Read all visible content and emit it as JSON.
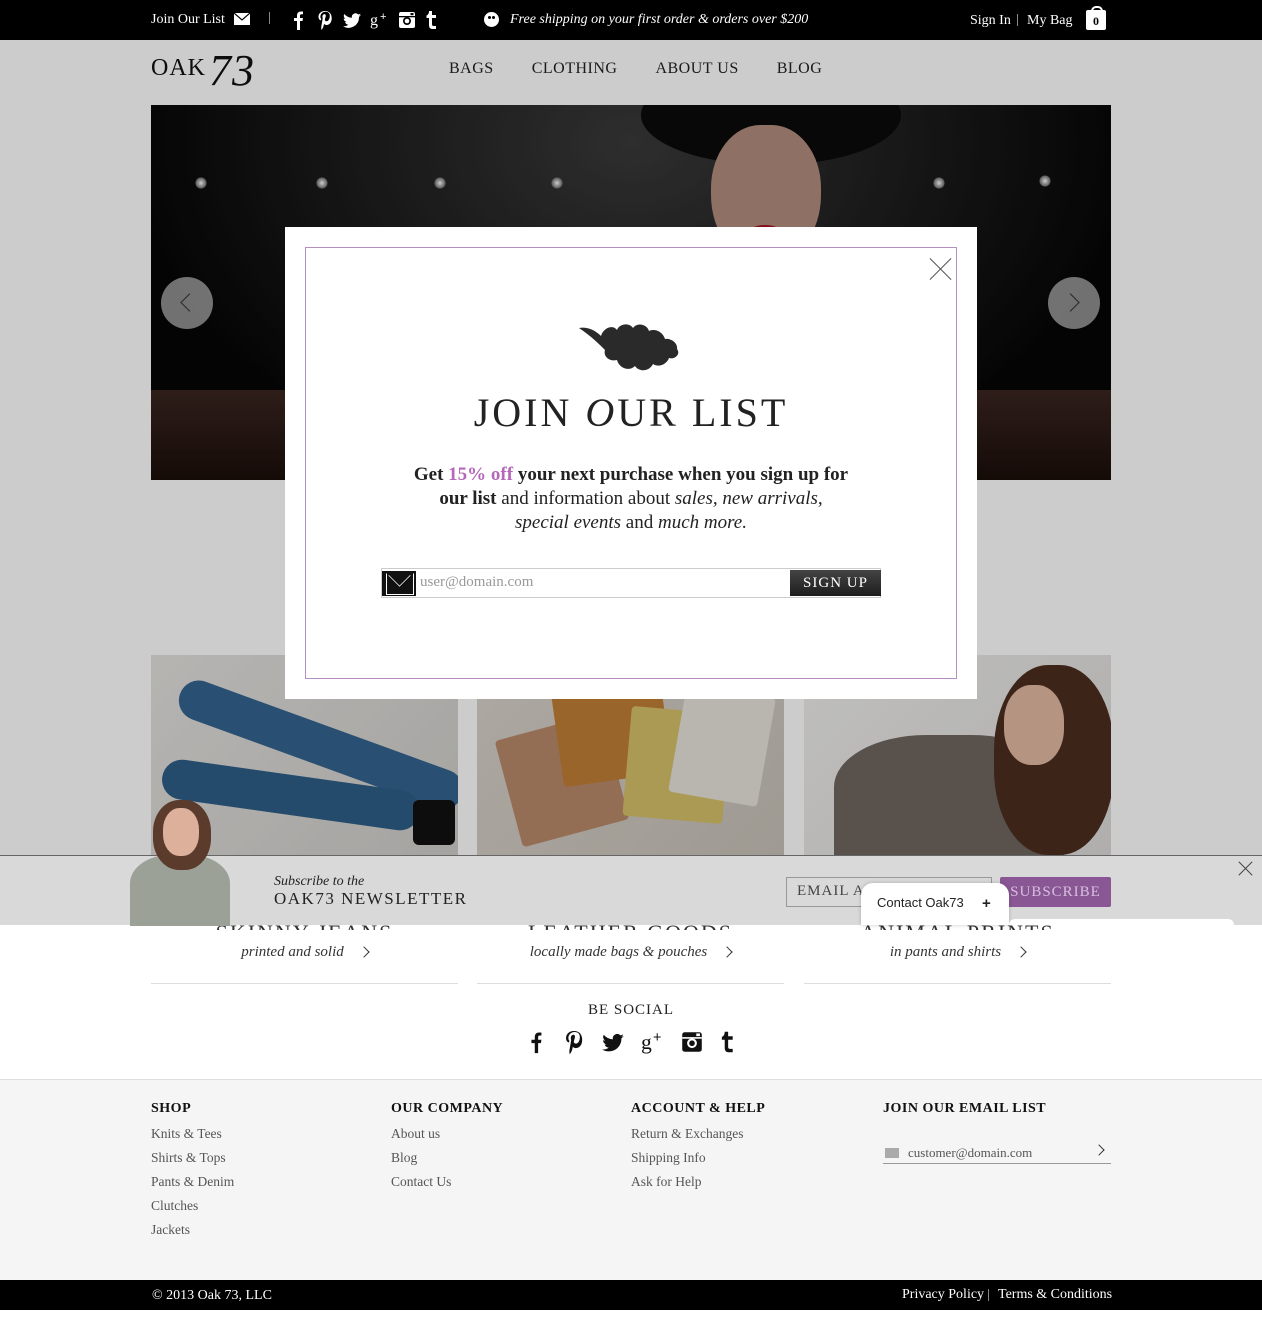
{
  "topbar": {
    "join_label": "Join Our List",
    "shipping_text": "Free shipping on your first order & orders over $200",
    "signin_label": "Sign In",
    "mybag_label": "My Bag",
    "bag_count": "0",
    "social_icons": [
      "facebook-icon",
      "pinterest-icon",
      "twitter-icon",
      "google-plus-icon",
      "instagram-icon",
      "tumblr-icon"
    ]
  },
  "header": {
    "logo_text": "OAK",
    "logo_script": "73",
    "nav": [
      "BAGS",
      "CLOTHING",
      "ABOUT US",
      "BLOG"
    ]
  },
  "modal": {
    "title_part1": "JOIN ",
    "title_o": "O",
    "title_part2": "UR LIST",
    "copy": {
      "get": "Get ",
      "discount": "15% off",
      "rest1": " your next purchase when you sign up for",
      "our_list": "our list",
      "rest2": " and information about ",
      "sales": "sales, new arrivals,",
      "special": "special events",
      "and": " and ",
      "more": "much more."
    },
    "email_placeholder": "user@domain.com",
    "signup_label": "SIGN UP"
  },
  "tiles": [
    {
      "title": "SKINNY JEANS",
      "subtitle": "printed and solid"
    },
    {
      "title": "LEATHER GOODS",
      "subtitle": "locally made bags & pouches"
    },
    {
      "title": "ANIMAL PRINTS",
      "subtitle": "in pants and shirts"
    }
  ],
  "newsletter_strip": {
    "line1": "Subscribe to the",
    "line2": "OAK73 NEWSLETTER",
    "email_placeholder": "EMAIL ADDRESS",
    "subscribe_label": "SUBSCRIBE",
    "accent_color": "#8a5795"
  },
  "contact_widget": {
    "label": "Contact Oak73",
    "plus": "+"
  },
  "social": {
    "label": "BE SOCIAL",
    "icons": [
      "facebook-icon",
      "pinterest-icon",
      "twitter-icon",
      "google-plus-icon",
      "instagram-icon",
      "tumblr-icon"
    ]
  },
  "footer": {
    "shop": {
      "title": "SHOP",
      "links": [
        "Knits & Tees",
        "Shirts & Tops",
        "Pants & Denim",
        "Clutches",
        "Jackets"
      ]
    },
    "company": {
      "title": "OUR COMPANY",
      "links": [
        "About us",
        "Blog",
        "Contact Us"
      ]
    },
    "help": {
      "title": "ACCOUNT & HELP",
      "links": [
        "Return & Exchanges",
        "Shipping Info",
        "Ask for Help"
      ]
    },
    "email": {
      "title": "JOIN OUR EMAIL LIST",
      "placeholder": "customer@domain.com"
    }
  },
  "bottombar": {
    "copyright": "© 2013 Oak 73,  LLC",
    "privacy": "Privacy Policy",
    "terms": "Terms & Conditions"
  }
}
